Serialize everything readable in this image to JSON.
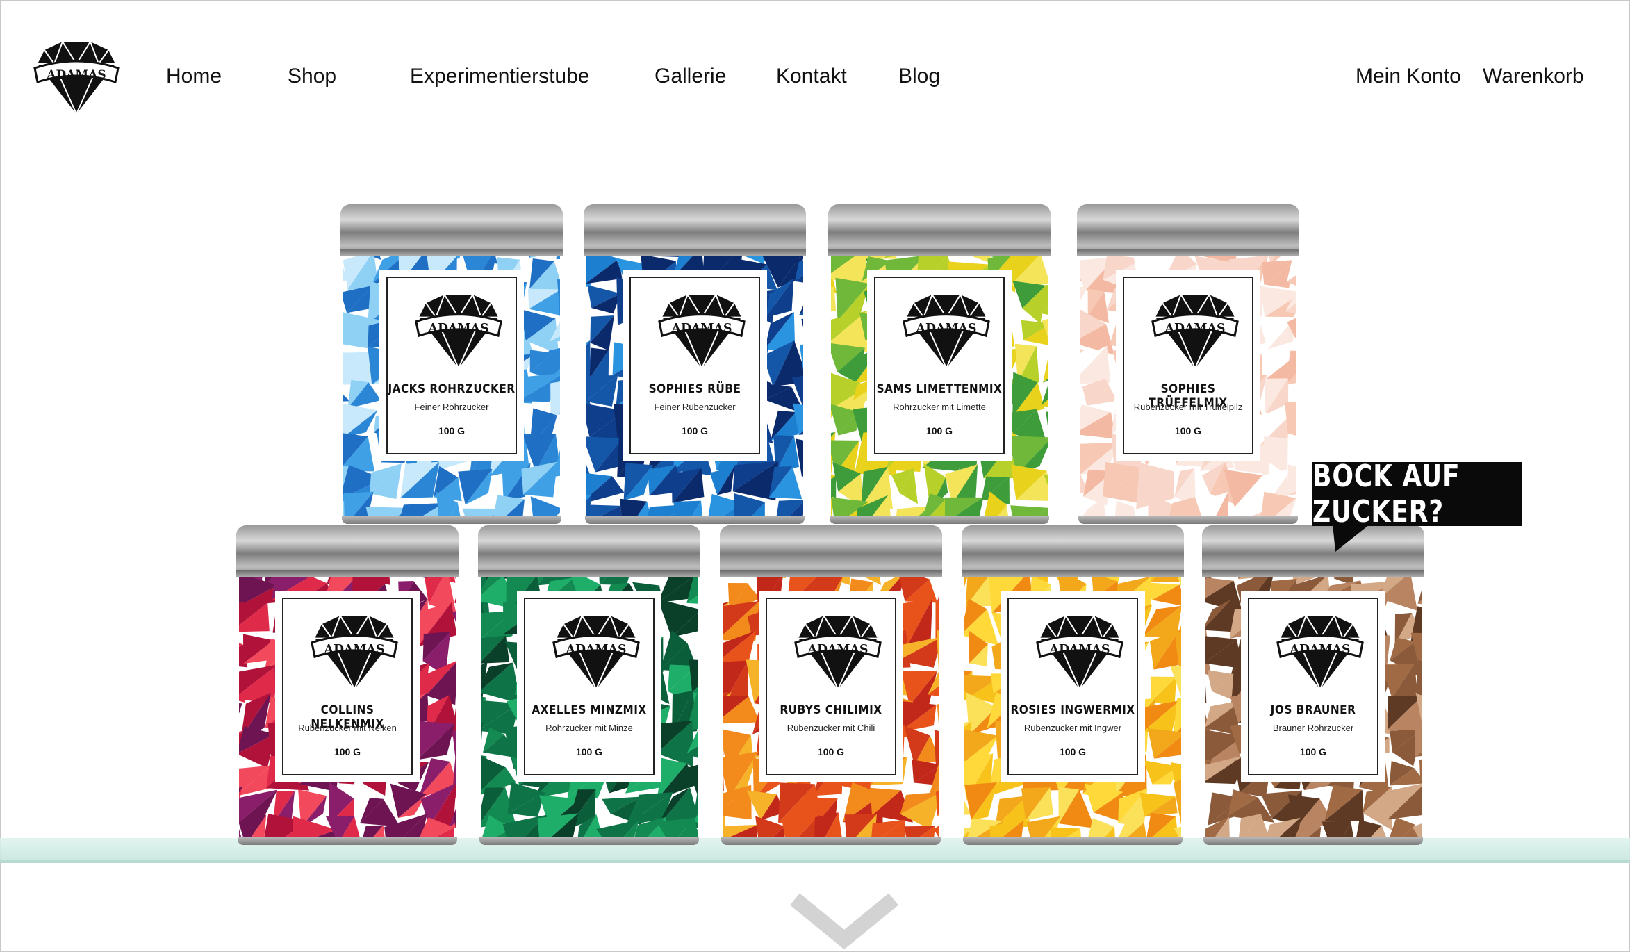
{
  "brand": {
    "logo_text": "ADAMAS"
  },
  "nav": {
    "items": [
      {
        "label": "Home"
      },
      {
        "label": "Shop"
      },
      {
        "label": "Experimentierstube"
      },
      {
        "label": "Gallerie"
      },
      {
        "label": "Kontakt"
      },
      {
        "label": "Blog"
      }
    ],
    "account": "Mein Konto",
    "cart": "Warenkorb"
  },
  "hero": {
    "speech_bubble": "BOCK AUF ZUCKER?",
    "scroll_icon": "chevron-down-icon",
    "tins": [
      {
        "name": "JACKS ROHRZUCKER",
        "desc": "Feiner Rohrzucker",
        "weight": "100 G",
        "palette": [
          "#1f6fc4",
          "#3fa0e6",
          "#8fd0f5",
          "#c8e9fb",
          "#2b86d6"
        ]
      },
      {
        "name": "SOPHIES RÜBE",
        "desc": "Feiner Rübenzucker",
        "weight": "100 G",
        "palette": [
          "#0b2a6b",
          "#1456a8",
          "#1d7fd0",
          "#0f3f8c",
          "#2a94e0"
        ]
      },
      {
        "name": "SAMS LIMETTENMIX",
        "desc": "Rohrzucker mit Limette",
        "weight": "100 G",
        "palette": [
          "#e9d21c",
          "#b7d12a",
          "#6fb83a",
          "#f3e45a",
          "#3f9c3a"
        ]
      },
      {
        "name": "SOPHIES TRÜFFELMIX",
        "desc": "Rübenzucker mit Trüffelpilz",
        "weight": "100 G",
        "palette": [
          "#f8d6c9",
          "#f3b9a3",
          "#fbe9e1",
          "#f7c8b4",
          "#ffffff"
        ]
      },
      {
        "name": "COLLINS NELKENMIX",
        "desc": "Rübenzucker mit Nelken",
        "weight": "100 G",
        "palette": [
          "#b1123a",
          "#e02a4a",
          "#6e1452",
          "#8a1e6a",
          "#f24a5c"
        ]
      },
      {
        "name": "AXELLES MINZMIX",
        "desc": "Rohrzucker mit Minze",
        "weight": "100 G",
        "palette": [
          "#0b5e3a",
          "#138a52",
          "#0a3f2a",
          "#1fae6a",
          "#0e7447"
        ]
      },
      {
        "name": "RUBYS CHILIMIX",
        "desc": "Rübenzucker mit Chili",
        "weight": "100 G",
        "palette": [
          "#e8531c",
          "#f28a1c",
          "#d23a1a",
          "#f6b32a",
          "#c2281a"
        ]
      },
      {
        "name": "ROSIES INGWERMIX",
        "desc": "Rübenzucker mit Ingwer",
        "weight": "100 G",
        "palette": [
          "#f7c21a",
          "#f2a81a",
          "#ffd93a",
          "#f08a12",
          "#fbe05a"
        ]
      },
      {
        "name": "JOS BRAUNER",
        "desc": "Brauner Rohrzucker",
        "weight": "100 G",
        "palette": [
          "#8a5a3a",
          "#b98462",
          "#5e3a24",
          "#d3a887",
          "#a06a45"
        ]
      }
    ]
  }
}
